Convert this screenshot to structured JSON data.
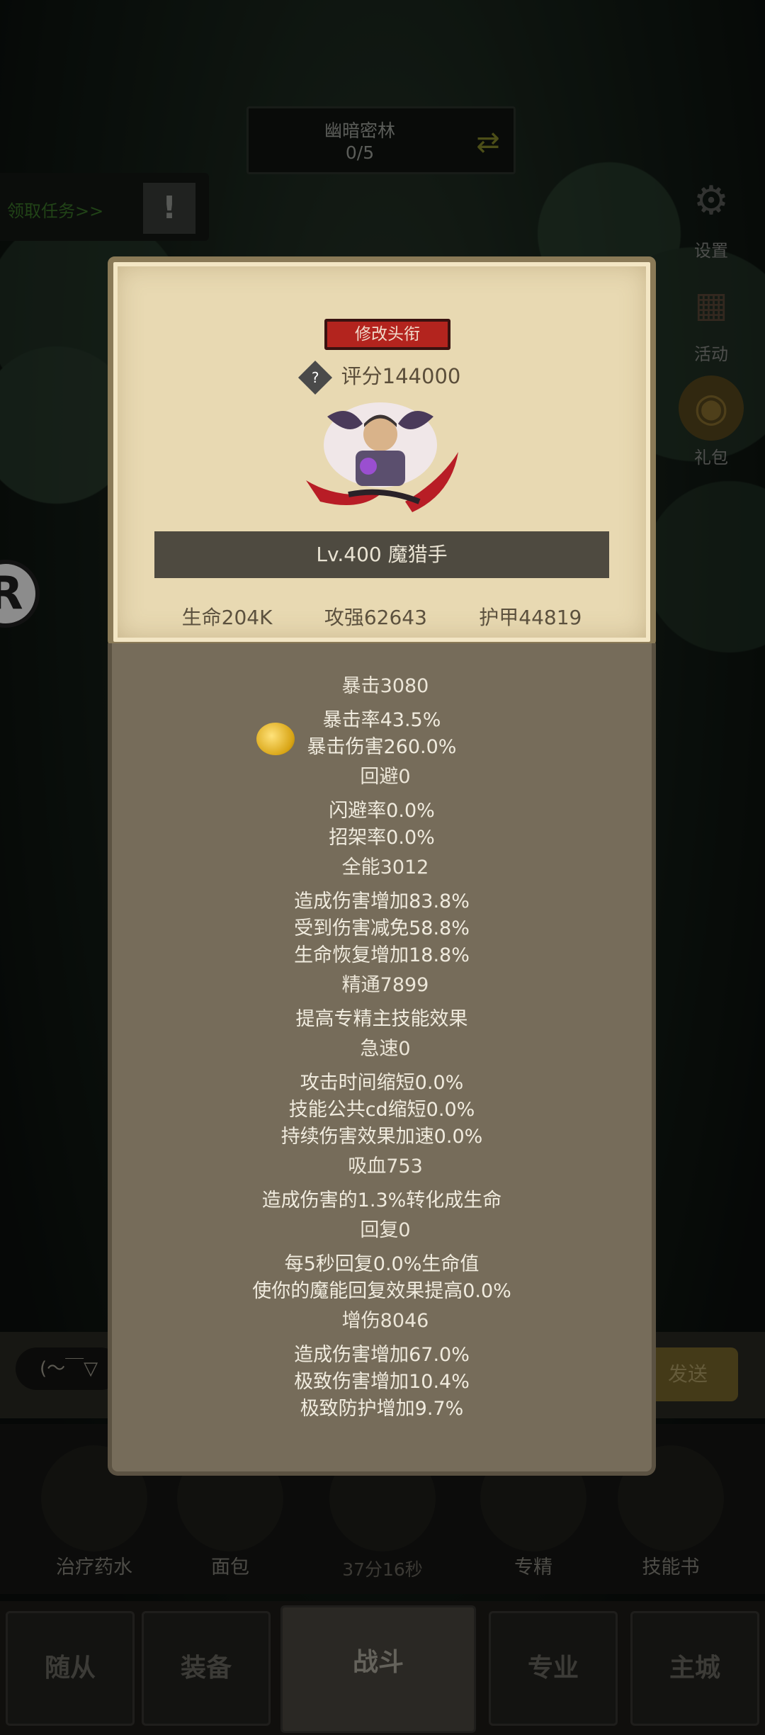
{
  "zone": {
    "name": "幽暗密林",
    "progress": "0/5"
  },
  "quest": {
    "label": "领取任务>>",
    "alert": "!"
  },
  "side": [
    {
      "label": "设置",
      "icon": "gear-icon"
    },
    {
      "label": "活动",
      "icon": "calendar-icon"
    },
    {
      "label": "礼包",
      "icon": "gift-icon"
    }
  ],
  "badge": "R",
  "profile": {
    "title_button": "修改头衔",
    "score": "评分144000",
    "level_name": "Lv.400 魔猎手",
    "hp": "生命204K",
    "atk": "攻强62643",
    "armor": "护甲44819"
  },
  "stats": [
    {
      "header": "暴击3080",
      "lines": [
        "暴击率43.5%",
        "暴击伤害260.0%"
      ]
    },
    {
      "header": "回避0",
      "lines": [
        "闪避率0.0%",
        "招架率0.0%"
      ]
    },
    {
      "header": "全能3012",
      "lines": [
        "造成伤害增加83.8%",
        "受到伤害减免58.8%",
        "生命恢复增加18.8%"
      ]
    },
    {
      "header": "精通7899",
      "lines": [
        "提高专精主技能效果"
      ]
    },
    {
      "header": "急速0",
      "lines": [
        "攻击时间缩短0.0%",
        "技能公共cd缩短0.0%",
        "持续伤害效果加速0.0%"
      ]
    },
    {
      "header": "吸血753",
      "lines": [
        "造成伤害的1.3%转化成生命"
      ]
    },
    {
      "header": "回复0",
      "lines": [
        "每5秒回复0.0%生命值",
        "使你的魔能回复效果提高0.0%"
      ]
    },
    {
      "header": "增伤8046",
      "lines": [
        "造成伤害增加67.0%",
        "极致伤害增加10.4%",
        "极致防护增加9.7%"
      ]
    }
  ],
  "chat": {
    "input": "(～￣▽",
    "send": "发送"
  },
  "items": [
    "治疗药水",
    "面包",
    "",
    "专精",
    "技能书"
  ],
  "timer": "37分16秒",
  "nav": [
    "随从",
    "装备",
    "战斗",
    "专业",
    "主城"
  ]
}
